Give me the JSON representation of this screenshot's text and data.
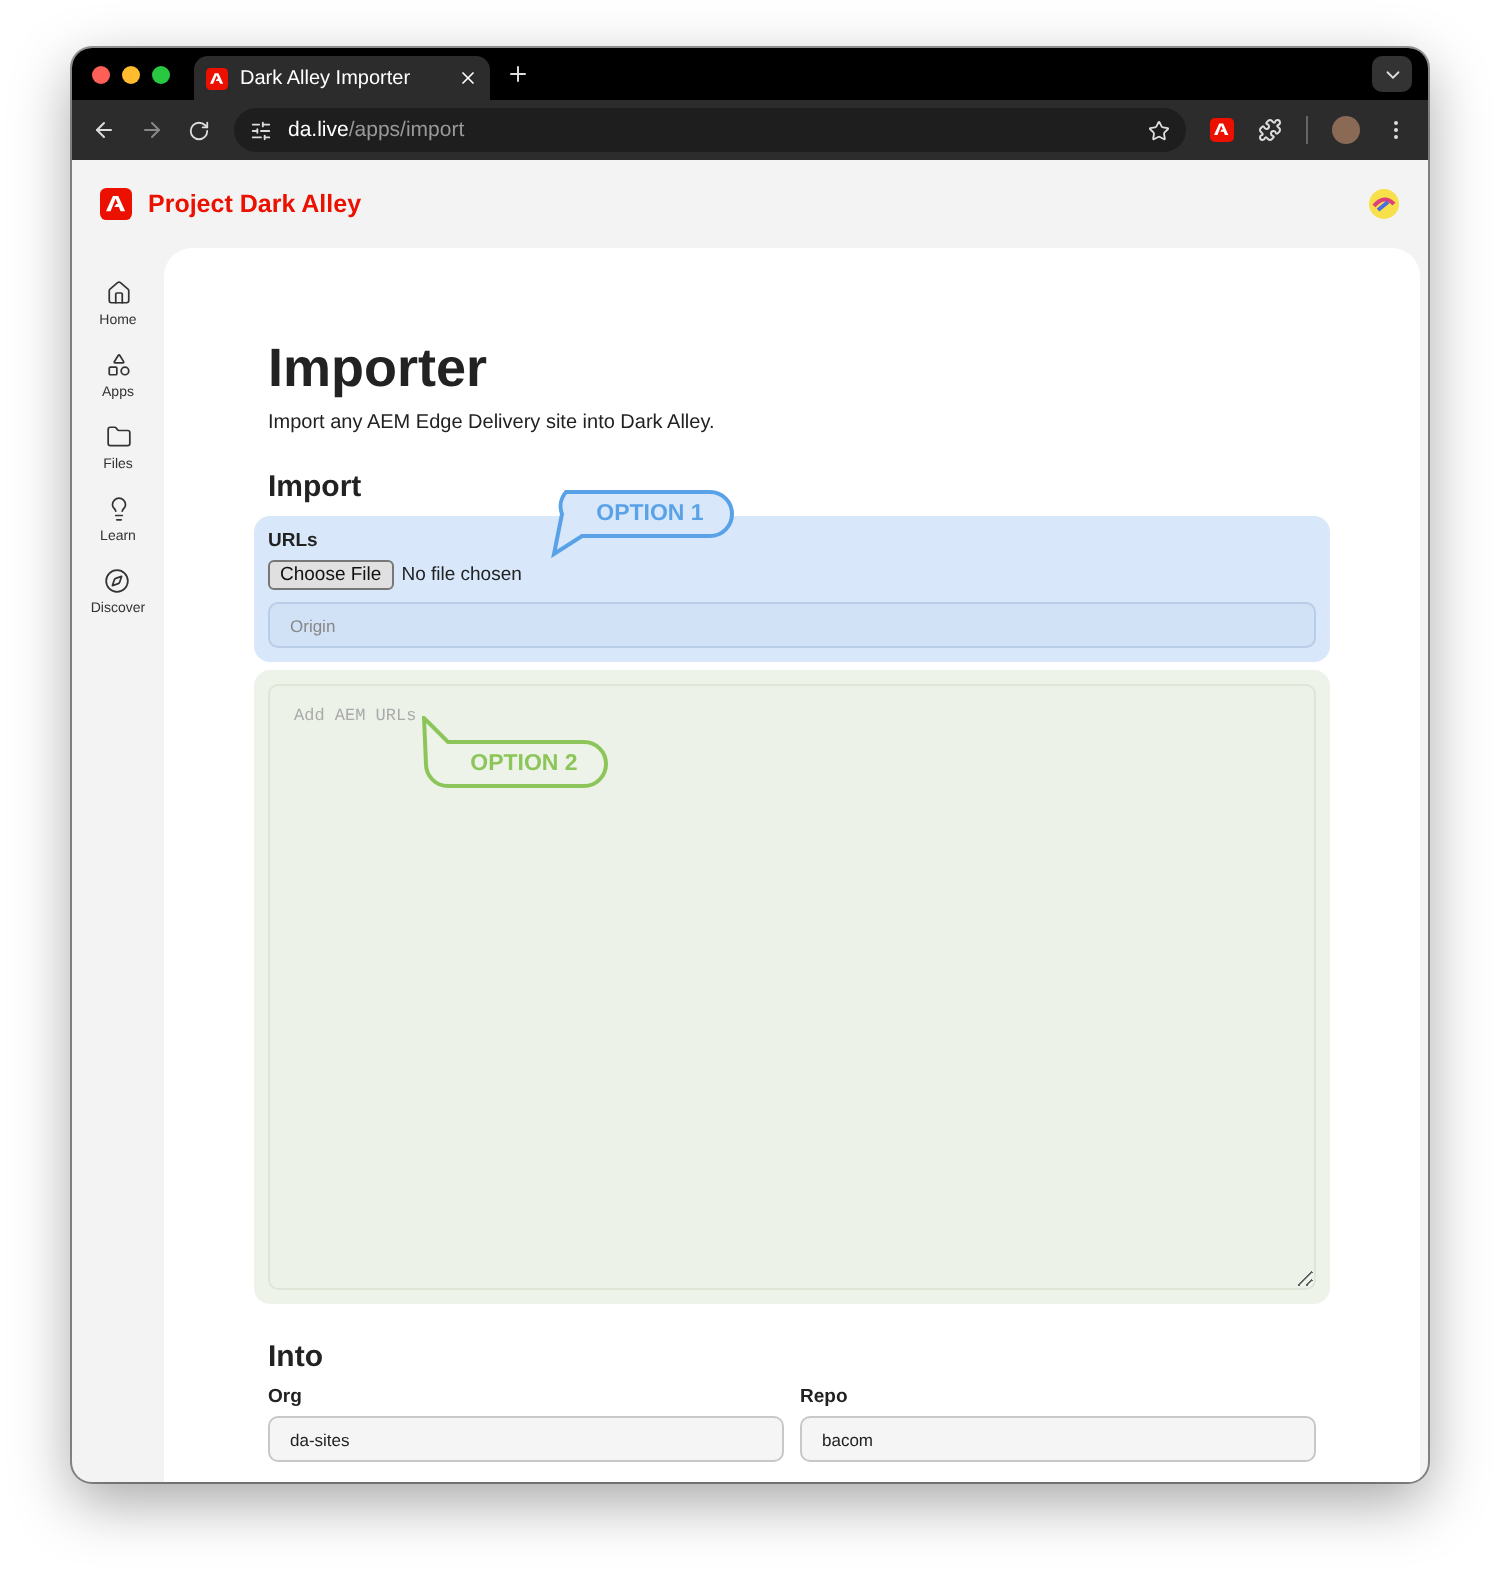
{
  "browser": {
    "tab_title": "Dark Alley Importer",
    "url_host": "da.live",
    "url_path": "/apps/import"
  },
  "app": {
    "name": "Project Dark Alley"
  },
  "sidebar": {
    "items": [
      {
        "label": "Home",
        "kind": "home"
      },
      {
        "label": "Apps",
        "kind": "apps"
      },
      {
        "label": "Files",
        "kind": "files"
      },
      {
        "label": "Learn",
        "kind": "learn"
      },
      {
        "label": "Discover",
        "kind": "discover"
      }
    ]
  },
  "page": {
    "title": "Importer",
    "subtitle": "Import any AEM Edge Delivery site into Dark Alley.",
    "import_heading": "Import",
    "urls_label": "URLs",
    "file_button": "Choose File",
    "file_status": "No file chosen",
    "origin_placeholder": "Origin",
    "urls_placeholder": "Add AEM URLs",
    "into_heading": "Into",
    "org": {
      "label": "Org",
      "value": "da-sites"
    },
    "repo": {
      "label": "Repo",
      "value": "bacom"
    }
  },
  "callouts": [
    {
      "text": "OPTION 1",
      "color": "#5aa2e8"
    },
    {
      "text": "OPTION 2",
      "color": "#8cc65a"
    }
  ]
}
